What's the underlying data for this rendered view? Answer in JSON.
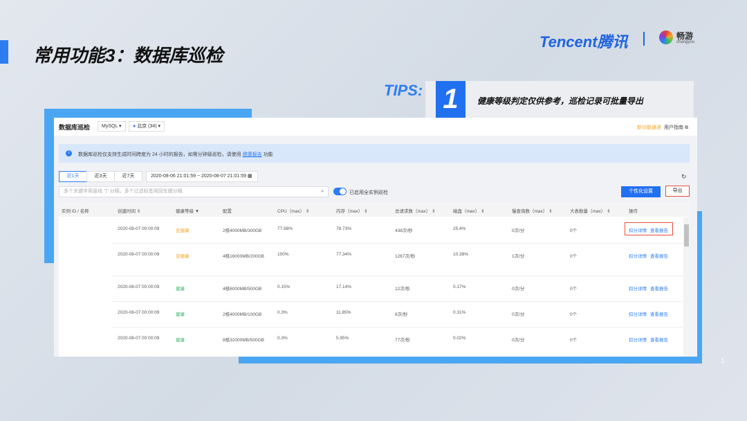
{
  "slide": {
    "title": "常用功能3：数据库巡检",
    "tips_label": "TIPS:",
    "tip_number": "1",
    "tip_text": "健康等级判定仅供参考，巡检记录可批量导出",
    "brand": "Tencent腾讯",
    "partner": "畅游",
    "partner_sub": "changyou",
    "page_number": "1"
  },
  "app": {
    "title": "数据库巡检",
    "db_type": "MySQL",
    "region": "北京 (34)",
    "new_features": "新功能速递",
    "user_guide": "用户指南",
    "banner_text": "数据库巡检仅支持生成时间跨度为 24 小时的报告，如需分钟级巡检，请使用",
    "banner_link": "健康报告",
    "banner_suffix": "功能",
    "time_tabs": [
      "近1天",
      "近3天",
      "近7天"
    ],
    "date_range": "2020-08-06 21:01:59 ~ 2020-08-07 21:01:59",
    "search_placeholder": "多个关键字用竖线 \"|\" 分隔，多个过滤标签用回车键分隔",
    "toggle_label": "已启用全实例巡检",
    "toggle_on": true,
    "customize_btn": "个性化设置",
    "export_btn": "导出"
  },
  "table": {
    "columns": [
      "实例 ID / 名称",
      "创建时间",
      "健康等级",
      "配置",
      "CPU（max）",
      "内存（max）",
      "总请求数（max）",
      "磁盘（max）",
      "慢查询数（max）",
      "大表数量（max）",
      "操作"
    ],
    "rows": [
      {
        "time": "2020-08-07 00:00:09",
        "health": "亚健康",
        "config": "2核4000MB/300GB",
        "cpu": "77.98%",
        "mem": "78.73%",
        "req": "438次/秒",
        "disk": "25.4%",
        "slow": "0次/分",
        "big": "0个",
        "op1": "扣分详情",
        "op2": "查看报告"
      },
      {
        "time": "2020-08-07 00:00:09",
        "health": "亚健康",
        "config": "4核16000MB/200GB",
        "cpu": "100%",
        "mem": "77.34%",
        "req": "1267次/秒",
        "disk": "10.38%",
        "slow": "1次/分",
        "big": "0个",
        "op1": "扣分详情",
        "op2": "查看报告"
      },
      {
        "time": "2020-08-07 00:00:09",
        "health": "健康",
        "config": "4核8000MB/500GB",
        "cpu": "0.15%",
        "mem": "17.14%",
        "req": "12次/秒",
        "disk": "0.17%",
        "slow": "0次/分",
        "big": "0个",
        "op1": "扣分详情",
        "op2": "查看报告"
      },
      {
        "time": "2020-08-07 00:00:09",
        "health": "健康",
        "config": "2核4000MB/100GB",
        "cpu": "0.3%",
        "mem": "11.85%",
        "req": "8次/秒",
        "disk": "0.31%",
        "slow": "0次/分",
        "big": "0个",
        "op1": "扣分详情",
        "op2": "查看报告"
      },
      {
        "time": "2020-08-07 00:00:09",
        "health": "健康",
        "config": "8核32000MB/500GB",
        "cpu": "0.3%",
        "mem": "5.95%",
        "req": "77次/秒",
        "disk": "0.02%",
        "slow": "0次/分",
        "big": "0个",
        "op1": "扣分详情",
        "op2": "查看报告"
      }
    ]
  },
  "colors": {
    "accent": "#2e7df0",
    "warning": "#f5a623",
    "healthy": "#3bb56c",
    "highlight": "#e74c3c"
  }
}
